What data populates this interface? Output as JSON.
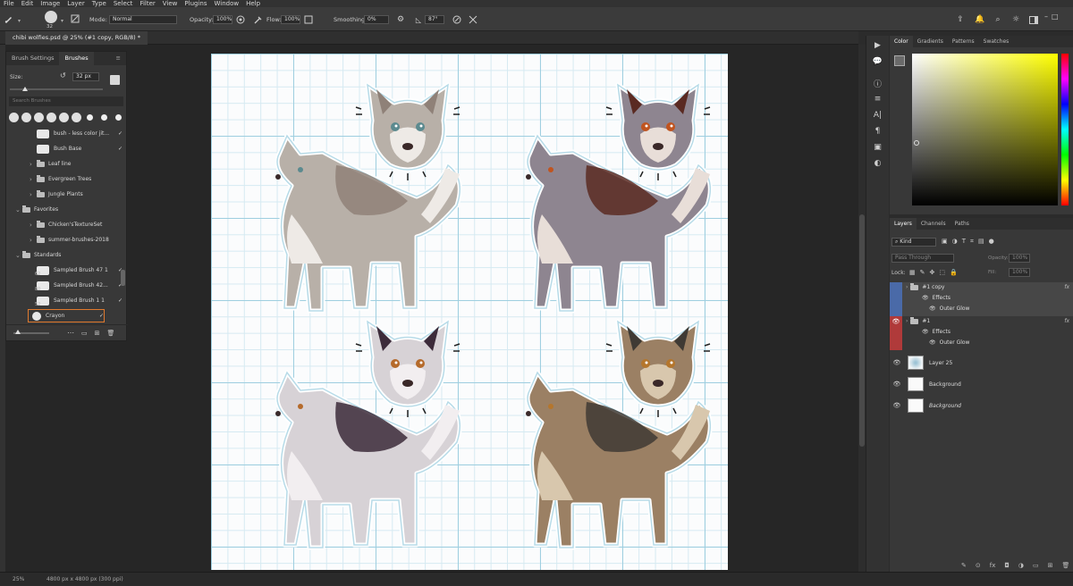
{
  "menu": [
    "File",
    "Edit",
    "Image",
    "Layer",
    "Type",
    "Select",
    "Filter",
    "View",
    "Plugins",
    "Window",
    "Help"
  ],
  "options": {
    "brush_size": "32",
    "mode_label": "Mode:",
    "mode_value": "Normal",
    "opacity_label": "Opacity:",
    "opacity_value": "100%",
    "flow_label": "Flow:",
    "flow_value": "100%",
    "smoothing_label": "Smoothing:",
    "smoothing_value": "0%",
    "angle_value": "87°"
  },
  "document": {
    "tab_title": "chibi wolfies.psd @ 25% (#1 copy, RGB/8) *"
  },
  "brushes_panel": {
    "tabs": [
      "Brush Settings",
      "Brushes"
    ],
    "size_label": "Size:",
    "size_value": "32 px",
    "search_placeholder": "Search Brushes",
    "items": [
      {
        "label": "bush - less color jit...",
        "kind": "brush"
      },
      {
        "label": "Bush Base",
        "kind": "brush"
      },
      {
        "label": "Leaf line",
        "kind": "folder"
      },
      {
        "label": "Evergreen Trees",
        "kind": "folder"
      },
      {
        "label": "Jungle Plants",
        "kind": "folder"
      },
      {
        "label": "Favorites",
        "kind": "group"
      },
      {
        "label": "Chicken'sTextureSet",
        "kind": "folder"
      },
      {
        "label": "summer-brushes-2018",
        "kind": "folder"
      },
      {
        "label": "Standards",
        "kind": "group"
      },
      {
        "label": "Sampled Brush 47 1",
        "kind": "brush",
        "num": "62"
      },
      {
        "label": "Sampled Brush 42...",
        "kind": "brush",
        "num": "80"
      },
      {
        "label": "Sampled Brush 1 1",
        "kind": "brush",
        "num": "52"
      },
      {
        "label": "Crayon",
        "kind": "brush",
        "selected": true
      }
    ]
  },
  "color_panel": {
    "tabs": [
      "Color",
      "Gradients",
      "Patterns",
      "Swatches"
    ],
    "hue_color": "#ffff00"
  },
  "layers_panel": {
    "tabs": [
      "Layers",
      "Channels",
      "Paths"
    ],
    "filter_label": "Kind",
    "blend_mode": "Pass Through",
    "opacity_label": "Opacity:",
    "opacity_value": "100%",
    "lock_label": "Lock:",
    "fill_label": "Fill:",
    "fill_value": "100%",
    "layers": [
      {
        "name": "#1 copy",
        "type": "group",
        "color": "#4a6aa8",
        "fx": "fx",
        "effects_label": "Effects",
        "effect": "Outer Glow"
      },
      {
        "name": "#1",
        "type": "group",
        "color": "#b03a3a",
        "fx": "fx",
        "effects_label": "Effects",
        "effect": "Outer Glow"
      },
      {
        "name": "Layer 25",
        "type": "layer"
      },
      {
        "name": "Background",
        "type": "layer"
      },
      {
        "name": "Background",
        "type": "background"
      }
    ]
  },
  "status": {
    "zoom": "25%",
    "dimensions": "4800 px x 4800 px (300 ppi)"
  },
  "artwork": {
    "stickers": [
      {
        "name": "grey-wolf",
        "body": "#b8b0a8",
        "dark": "#8f8178",
        "light": "#eeeae6",
        "eye": "#5b8a8f"
      },
      {
        "name": "maned-wolf",
        "body": "#8e8590",
        "dark": "#5a2a22",
        "light": "#e8ded8",
        "eye": "#c0541f"
      },
      {
        "name": "calico-wolf",
        "body": "#d7d2d6",
        "dark": "#3c2b3a",
        "light": "#f2eef0",
        "eye": "#b56a2b"
      },
      {
        "name": "brown-wolf",
        "body": "#9b8064",
        "dark": "#3f3a34",
        "light": "#d8c7ad",
        "eye": "#b5762c"
      }
    ]
  }
}
